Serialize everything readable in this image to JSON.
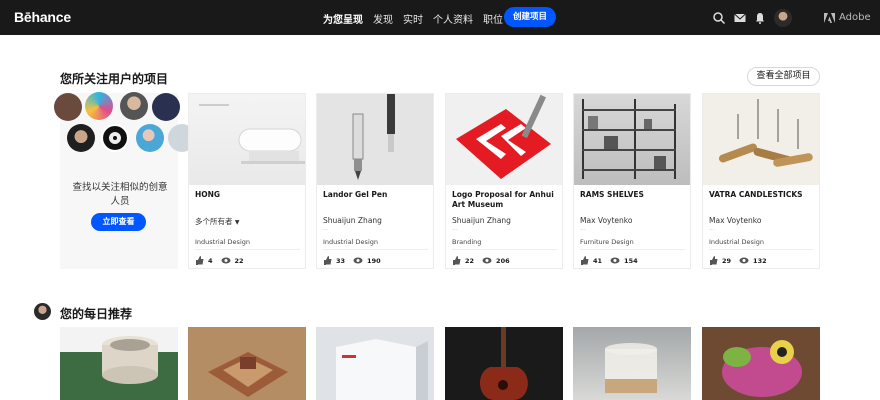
{
  "header": {
    "logo": "Bēhance",
    "nav": [
      "为您呈现",
      "发现",
      "实时",
      "个人资料",
      "职位"
    ],
    "create_label": "创建项目",
    "adobe_label": "Adobe",
    "icons": [
      "search-icon",
      "mail-icon",
      "bell-icon"
    ]
  },
  "following": {
    "title": "您所关注用户的项目",
    "see_all": "查看全部项目",
    "find_text": "查找以关注相似的创意人员",
    "find_button": "立即查看"
  },
  "projects": [
    {
      "title": "HONG",
      "owner": "多个所有者",
      "dots": "···",
      "field": "Industrial Design",
      "likes": "4",
      "views": "22"
    },
    {
      "title": "Landor Gel Pen",
      "owner": "Shuaijun Zhang",
      "dots": "···",
      "field": "Industrial Design",
      "likes": "33",
      "views": "190"
    },
    {
      "title": "Logo Proposal for Anhui Art Museum",
      "owner": "Shuaijun Zhang",
      "dots": "···",
      "field": "Branding",
      "likes": "22",
      "views": "206"
    },
    {
      "title": "RAMS SHELVES",
      "owner": "Max Voytenko",
      "dots": "···",
      "field": "Furniture Design",
      "likes": "41",
      "views": "154"
    },
    {
      "title": "VATRA CANDLESTICKS",
      "owner": "Max Voytenko",
      "dots": "···",
      "field": "Industrial Design",
      "likes": "29",
      "views": "132"
    }
  ],
  "daily": {
    "title": "您的每日推荐"
  },
  "colors": {
    "accent": "#0057ff",
    "topbar": "#191919"
  }
}
